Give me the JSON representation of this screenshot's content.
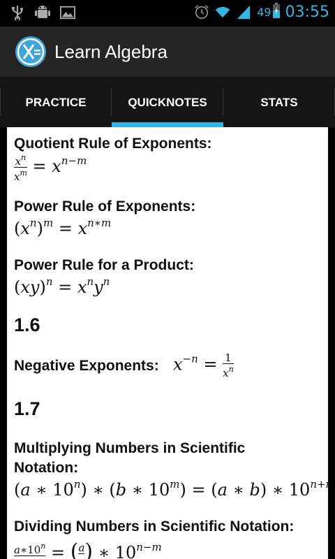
{
  "status": {
    "time": "03:55",
    "battery": "49",
    "icons": [
      "usb-icon",
      "android-debug-icon",
      "image-icon",
      "alarm-icon",
      "wifi-icon",
      "signal-icon",
      "battery-icon"
    ]
  },
  "app": {
    "title": "Learn Algebra",
    "logo_icon": "x-equals-logo-icon",
    "accent": "#33b5e5"
  },
  "tabs": [
    {
      "label": "PRACTICE",
      "active": false
    },
    {
      "label": "QUICKNOTES",
      "active": true
    },
    {
      "label": "STATS",
      "active": false
    }
  ],
  "notes": {
    "quotient_rule": {
      "title": "Quotient Rule of Exponents:"
    },
    "power_rule": {
      "title": "Power Rule of Exponents:"
    },
    "power_product": {
      "title": "Power Rule for a Product:"
    },
    "section_1_6": "1.6",
    "negative_exponents": {
      "title": "Negative Exponents:"
    },
    "section_1_7": "1.7",
    "multiply_sci": {
      "title": "Multiplying Numbers in Scientific Notation:"
    },
    "divide_sci": {
      "title": "Dividing Numbers in Scientific Notation:"
    }
  }
}
